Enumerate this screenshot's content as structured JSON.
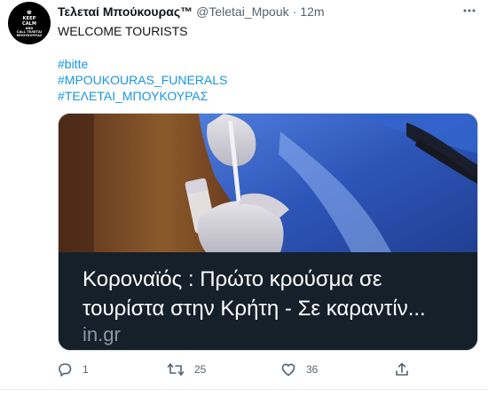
{
  "tweet": {
    "avatar_text": {
      "crown": "♚",
      "line1": "KEEP",
      "line2": "CALM",
      "line3": "AND",
      "line4": "CALL ΤΕΛΕΤΑΙ",
      "line5": "ΜΠΟΥΚΟΥΡΑΣ"
    },
    "display_name": "Τελεταί Μπούκουρας™",
    "handle": "@Teletai_Mpouk",
    "separator": "·",
    "time": "12m",
    "more_icon": "more-horizontal-icon",
    "text_line": "WELCOME TOURISTS",
    "hashtags": [
      "#bitte",
      "#MPOUKOURAS_FUNERALS",
      "#ΤΕΛΕΤΑΙ_ΜΠΟΥΚΟΥΡΑΣ"
    ],
    "card": {
      "title": "Κοροναϊός : Πρώτο κρούσμα σε τουρίστα στην Κρήτη - Σε καραντίν...",
      "domain": "in.gr"
    },
    "actions": {
      "reply_count": "1",
      "retweet_count": "25",
      "like_count": "36"
    },
    "colors": {
      "link": "#1b95e0",
      "secondary": "#536471",
      "card_bg": "#15202b",
      "card_domain": "#8899a6"
    }
  }
}
